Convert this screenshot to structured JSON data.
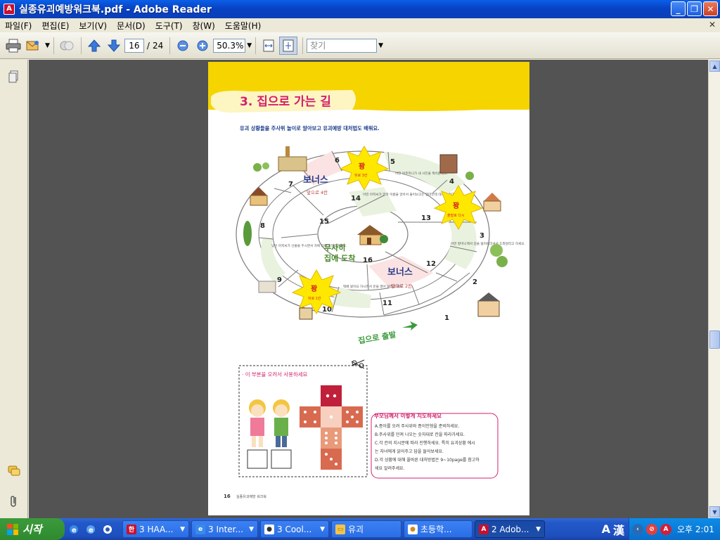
{
  "window": {
    "title": "실종유괴예방워크북.pdf - Adobe Reader",
    "minimize": "_",
    "maximize": "❐",
    "close": "✕",
    "doc_close": "✕"
  },
  "menu": [
    "파일(F)",
    "편집(E)",
    "보기(V)",
    "문서(D)",
    "도구(T)",
    "창(W)",
    "도움말(H)"
  ],
  "toolbar": {
    "current_page": "16",
    "page_sep": "/",
    "total_pages": "24",
    "zoom": "50.3%",
    "find_placeholder": "찾기"
  },
  "page_content": {
    "chapter_title": "3. 집으로 가는 길",
    "intro": "유괴 상황들을 주사위 놀이로 알아보고 유괴예방 대처법도 배워요.",
    "board": {
      "bonus_top": "보너스",
      "bonus_top_sub": "앞으로 4칸",
      "bonus_bottom": "보너스",
      "bonus_bottom_sub": "앞으로 2칸",
      "center_line1": "무사히",
      "center_line2": "집에 도착",
      "start_label": "집으로 출발",
      "bang": "꽝",
      "bang_back3": "뒤로 3칸",
      "bang_restart": "출발로 다시",
      "bang_back1": "뒤로 1칸",
      "cell_numbers": [
        "1",
        "2",
        "3",
        "4",
        "5",
        "6",
        "7",
        "8",
        "9",
        "10",
        "11",
        "12",
        "13",
        "14",
        "15",
        "16"
      ],
      "cell5_text": "어떤 아주머니가 내 사진을 찍어준대요.",
      "cell14_text": "어떤 아저씨가 엄마 이름을 알아서 물어보고는 엄마한테 데려다 준대요.",
      "cell3_text": "어떤 할머니께서 길을 잃어버리셔서 도와달라고 하세요.",
      "cell8_text": "낯선 아저씨가 선물을 주시면서 차에 타라고 말씀하세요.",
      "cell10_text": "택배 왔어요 하시면서 문을 열어 달라고 해요."
    },
    "cutout_label": "· 이 부분을 오려서 사용하세요",
    "parents_heading": "부모님께서 이렇게 지도하세요",
    "parents_items": [
      "A.종이를 오려 주사위와 종이인형을 준비하세요.",
      "B.주사위를 던져 나오는 숫자대로 칸을 따라가세요.",
      "C.각 칸의 지시문에 따라 진행하세요. 특히 유괴상황 에시",
      "   는 자녀에게 읽어주고 답을 들어보세요.",
      "D.각 상황에 대해 올바른 대처방법은 9~10page를 참고하",
      "   세요 알려주세요."
    ],
    "page_number": "16",
    "footer_text": "실종유괴예방 워크북"
  },
  "taskbar": {
    "start": "시작",
    "tasks": [
      {
        "label": "3 HAA...",
        "active": false
      },
      {
        "label": "3 Inter...",
        "active": false
      },
      {
        "label": "3 Cool...",
        "active": false
      },
      {
        "label": "유괴",
        "active": false
      },
      {
        "label": "초등학...",
        "active": false
      },
      {
        "label": "2 Adob...",
        "active": true
      }
    ],
    "ime_a": "A",
    "ime_han": "漢",
    "clock": "오후 2:01"
  },
  "colors": {
    "title_blue": "#0a4fd8",
    "page_yellow": "#f5d400",
    "pdf_red": "#c8102e",
    "board_green": "#e9f2df",
    "board_pink": "#fbe3e3"
  }
}
